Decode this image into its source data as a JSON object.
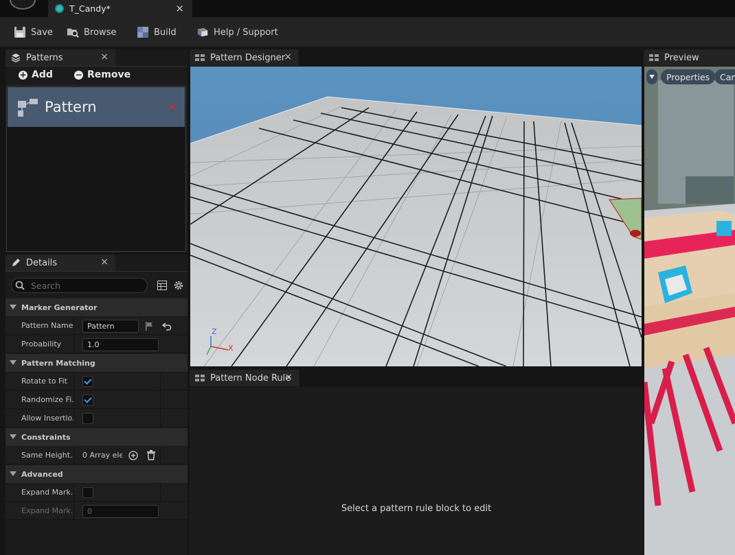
{
  "window": {
    "tab_title": "T_Candy*",
    "tab_close": "×"
  },
  "toolbar": {
    "save_label": "Save",
    "browse_label": "Browse",
    "build_label": "Build",
    "help_label": "Help / Support"
  },
  "patterns_panel": {
    "title": "Patterns",
    "add_label": "Add",
    "remove_label": "Remove",
    "items": [
      {
        "label": "Pattern"
      }
    ]
  },
  "details_panel": {
    "title": "Details",
    "search_placeholder": "Search",
    "categories": {
      "marker_generator": "Marker Generator",
      "pattern_matching": "Pattern Matching",
      "constraints": "Constraints",
      "advanced": "Advanced"
    },
    "properties": {
      "pattern_name": {
        "label": "Pattern Name",
        "value": "Pattern"
      },
      "probability": {
        "label": "Probability",
        "value": "1.0"
      },
      "rotate_to_fit": {
        "label": "Rotate to Fit",
        "checked": true
      },
      "randomize_fit": {
        "label": "Randomize Fi...",
        "checked": true
      },
      "allow_insertion": {
        "label": "Allow Insertio...",
        "checked": false
      },
      "same_height": {
        "label": "Same Height...",
        "value": "0 Array eler"
      },
      "expand_marker_1": {
        "label": "Expand Mark...",
        "checked": false
      },
      "expand_marker_2": {
        "label": "Expand Mark...",
        "value": "0"
      }
    }
  },
  "pattern_designer": {
    "title": "Pattern Designer",
    "axis_labels": {
      "z": "Z",
      "x": "X"
    }
  },
  "pattern_node_rule": {
    "title": "Pattern Node Rule",
    "empty_message": "Select a pattern rule block to edit"
  },
  "preview": {
    "title": "Preview",
    "properties_label": "Properties",
    "camera_label": "Cam"
  },
  "colors": {
    "selected_row": "#475a70",
    "accent_check": "#3c9cf3",
    "delete_red": "#d62a2a",
    "sky": "#4f8ab8"
  }
}
